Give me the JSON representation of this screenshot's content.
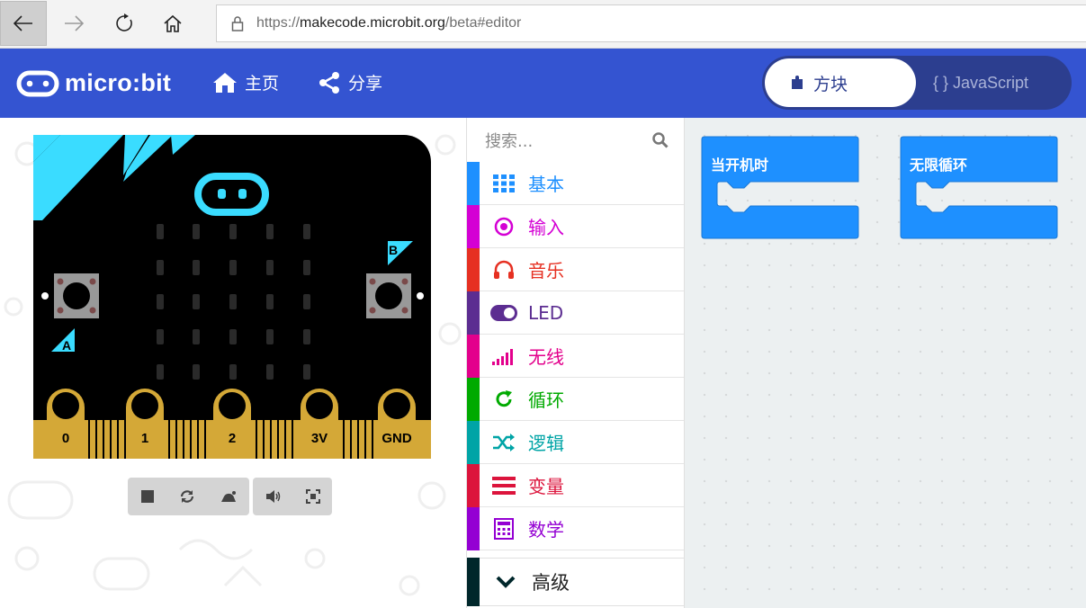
{
  "browser": {
    "url_prefix": "https://",
    "url_host": "makecode.microbit.org",
    "url_path": "/beta#editor"
  },
  "header": {
    "logo_text": "micro:bit",
    "home_label": "主页",
    "share_label": "分享",
    "blocks_label": "方块",
    "javascript_label": "{ } JavaScript"
  },
  "simulator": {
    "pins": [
      "0",
      "1",
      "2",
      "3V",
      "GND"
    ],
    "button_a": "A",
    "button_b": "B"
  },
  "toolbox": {
    "search_placeholder": "搜索...",
    "categories": [
      {
        "label": "基本",
        "color": "#1e90ff",
        "icon": "grid-icon"
      },
      {
        "label": "输入",
        "color": "#d400d4",
        "icon": "target-icon"
      },
      {
        "label": "音乐",
        "color": "#e63022",
        "icon": "headphones-icon"
      },
      {
        "label": "LED",
        "color": "#5c2d91",
        "icon": "toggle-icon"
      },
      {
        "label": "无线",
        "color": "#e3008c",
        "icon": "signal-icon"
      },
      {
        "label": "循环",
        "color": "#00aa00",
        "icon": "refresh-icon"
      },
      {
        "label": "逻辑",
        "color": "#00a4a6",
        "icon": "shuffle-icon"
      },
      {
        "label": "变量",
        "color": "#dc143c",
        "icon": "list-icon"
      },
      {
        "label": "数学",
        "color": "#9400d3",
        "icon": "calculator-icon"
      }
    ],
    "advanced_label": "高级",
    "advanced_color": "#00272b"
  },
  "workspace": {
    "blocks": [
      {
        "label": "当开机时"
      },
      {
        "label": "无限循环"
      }
    ]
  }
}
